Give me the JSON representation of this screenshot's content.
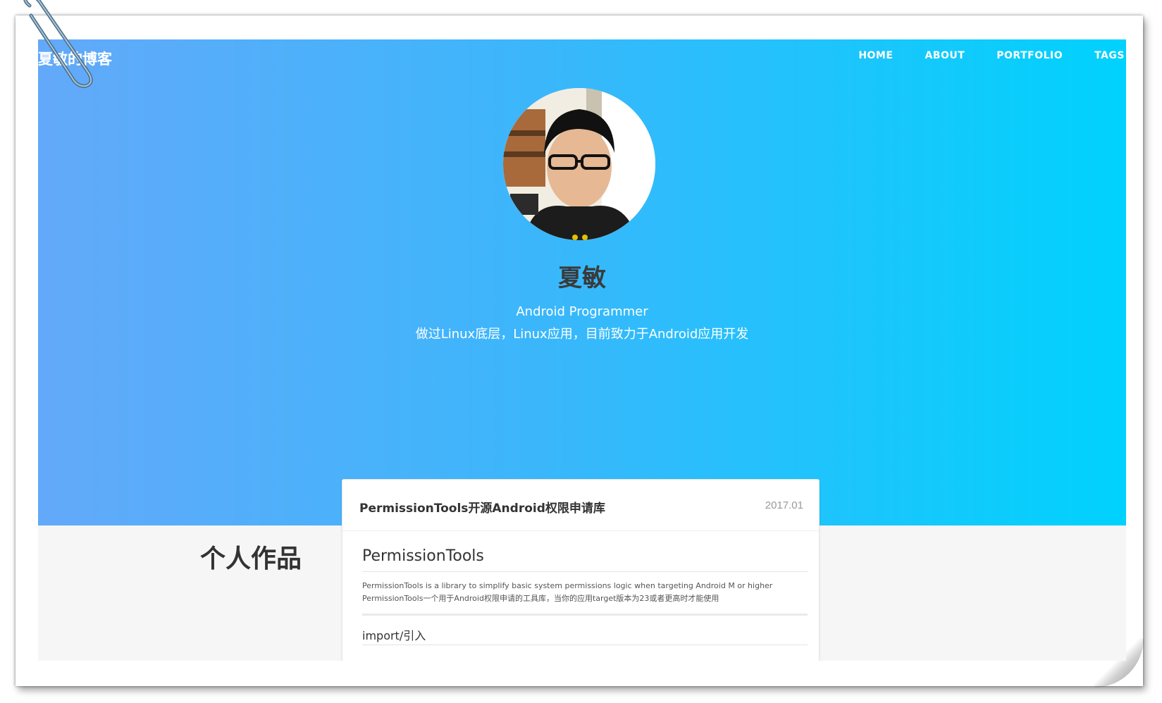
{
  "header": {
    "brand": "夏敏的博客",
    "nav": [
      "HOME",
      "ABOUT",
      "PORTFOLIO",
      "TAGS"
    ]
  },
  "profile": {
    "name": "夏敏",
    "role": "Android Programmer",
    "bio": "做过Linux底层，Linux应用，目前致力于Android应用开发"
  },
  "section": {
    "title": "个人作品"
  },
  "card": {
    "title": "PermissionTools开源Android权限申请库",
    "date": "2017.01",
    "readme_title": "PermissionTools",
    "readme_line1": "PermissionTools is a library to simplify basic system permissions logic when targeting Android M or higher",
    "readme_line2": "PermissionTools一个用于Android权限申请的工具库，当你的应用target版本为23或者更高时才能使用",
    "readme_h2": "import/引入"
  },
  "colors": {
    "hero_start": "#63a9f9",
    "hero_end": "#00d2fd",
    "name_text": "#3a3a3a"
  },
  "icons": {
    "paperclip": "paperclip-icon"
  }
}
